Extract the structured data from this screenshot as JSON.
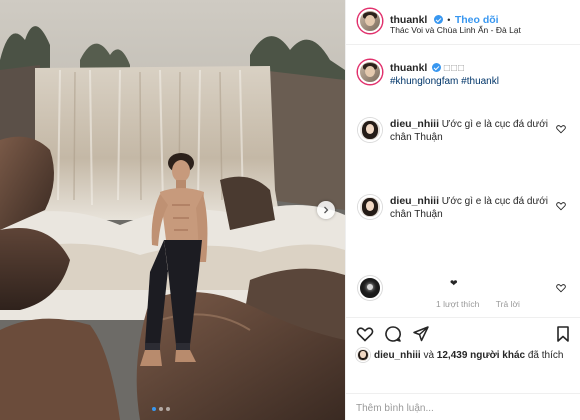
{
  "post": {
    "author": "thuankl",
    "follow_label": "Theo dõi",
    "separator": "•",
    "location": "Thác Voi và Chùa Linh Ẩn - Đà Lạt"
  },
  "caption": {
    "author": "thuankl",
    "emoji": "□□□",
    "hashtags": "#khunglongfam #thuankl"
  },
  "comments": [
    {
      "author": "dieu_nhiii",
      "text": "Ước gì e là cục đá dưới chân Thuận"
    },
    {
      "author": "dieu_nhiii",
      "text": "Ước gì e là cục đá dưới chân Thuận"
    }
  ],
  "reply": {
    "symbol": "❤",
    "likes_text": "1 lượt thích",
    "reply_label": "Trả lời"
  },
  "likes": {
    "first_user": "dieu_nhiii",
    "connector": " và ",
    "others": "12,439 người khác",
    "suffix": " đã thích"
  },
  "comment_input": {
    "placeholder": "Thêm bình luận..."
  },
  "carousel": {
    "slide_count": 3,
    "active_index": 0
  },
  "colors": {
    "accent": "#3897f0",
    "story_ring": "#e1306c",
    "text": "#262626",
    "muted": "#999999"
  }
}
